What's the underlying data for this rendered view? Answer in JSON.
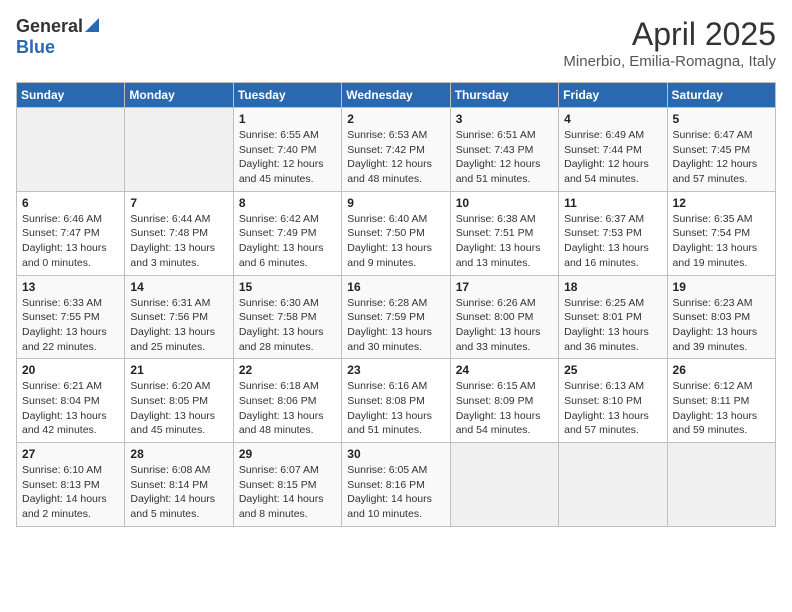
{
  "header": {
    "logo_general": "General",
    "logo_blue": "Blue",
    "month_title": "April 2025",
    "location": "Minerbio, Emilia-Romagna, Italy"
  },
  "weekdays": [
    "Sunday",
    "Monday",
    "Tuesday",
    "Wednesday",
    "Thursday",
    "Friday",
    "Saturday"
  ],
  "weeks": [
    [
      {
        "day": "",
        "info": ""
      },
      {
        "day": "",
        "info": ""
      },
      {
        "day": "1",
        "info": "Sunrise: 6:55 AM\nSunset: 7:40 PM\nDaylight: 12 hours\nand 45 minutes."
      },
      {
        "day": "2",
        "info": "Sunrise: 6:53 AM\nSunset: 7:42 PM\nDaylight: 12 hours\nand 48 minutes."
      },
      {
        "day": "3",
        "info": "Sunrise: 6:51 AM\nSunset: 7:43 PM\nDaylight: 12 hours\nand 51 minutes."
      },
      {
        "day": "4",
        "info": "Sunrise: 6:49 AM\nSunset: 7:44 PM\nDaylight: 12 hours\nand 54 minutes."
      },
      {
        "day": "5",
        "info": "Sunrise: 6:47 AM\nSunset: 7:45 PM\nDaylight: 12 hours\nand 57 minutes."
      }
    ],
    [
      {
        "day": "6",
        "info": "Sunrise: 6:46 AM\nSunset: 7:47 PM\nDaylight: 13 hours\nand 0 minutes."
      },
      {
        "day": "7",
        "info": "Sunrise: 6:44 AM\nSunset: 7:48 PM\nDaylight: 13 hours\nand 3 minutes."
      },
      {
        "day": "8",
        "info": "Sunrise: 6:42 AM\nSunset: 7:49 PM\nDaylight: 13 hours\nand 6 minutes."
      },
      {
        "day": "9",
        "info": "Sunrise: 6:40 AM\nSunset: 7:50 PM\nDaylight: 13 hours\nand 9 minutes."
      },
      {
        "day": "10",
        "info": "Sunrise: 6:38 AM\nSunset: 7:51 PM\nDaylight: 13 hours\nand 13 minutes."
      },
      {
        "day": "11",
        "info": "Sunrise: 6:37 AM\nSunset: 7:53 PM\nDaylight: 13 hours\nand 16 minutes."
      },
      {
        "day": "12",
        "info": "Sunrise: 6:35 AM\nSunset: 7:54 PM\nDaylight: 13 hours\nand 19 minutes."
      }
    ],
    [
      {
        "day": "13",
        "info": "Sunrise: 6:33 AM\nSunset: 7:55 PM\nDaylight: 13 hours\nand 22 minutes."
      },
      {
        "day": "14",
        "info": "Sunrise: 6:31 AM\nSunset: 7:56 PM\nDaylight: 13 hours\nand 25 minutes."
      },
      {
        "day": "15",
        "info": "Sunrise: 6:30 AM\nSunset: 7:58 PM\nDaylight: 13 hours\nand 28 minutes."
      },
      {
        "day": "16",
        "info": "Sunrise: 6:28 AM\nSunset: 7:59 PM\nDaylight: 13 hours\nand 30 minutes."
      },
      {
        "day": "17",
        "info": "Sunrise: 6:26 AM\nSunset: 8:00 PM\nDaylight: 13 hours\nand 33 minutes."
      },
      {
        "day": "18",
        "info": "Sunrise: 6:25 AM\nSunset: 8:01 PM\nDaylight: 13 hours\nand 36 minutes."
      },
      {
        "day": "19",
        "info": "Sunrise: 6:23 AM\nSunset: 8:03 PM\nDaylight: 13 hours\nand 39 minutes."
      }
    ],
    [
      {
        "day": "20",
        "info": "Sunrise: 6:21 AM\nSunset: 8:04 PM\nDaylight: 13 hours\nand 42 minutes."
      },
      {
        "day": "21",
        "info": "Sunrise: 6:20 AM\nSunset: 8:05 PM\nDaylight: 13 hours\nand 45 minutes."
      },
      {
        "day": "22",
        "info": "Sunrise: 6:18 AM\nSunset: 8:06 PM\nDaylight: 13 hours\nand 48 minutes."
      },
      {
        "day": "23",
        "info": "Sunrise: 6:16 AM\nSunset: 8:08 PM\nDaylight: 13 hours\nand 51 minutes."
      },
      {
        "day": "24",
        "info": "Sunrise: 6:15 AM\nSunset: 8:09 PM\nDaylight: 13 hours\nand 54 minutes."
      },
      {
        "day": "25",
        "info": "Sunrise: 6:13 AM\nSunset: 8:10 PM\nDaylight: 13 hours\nand 57 minutes."
      },
      {
        "day": "26",
        "info": "Sunrise: 6:12 AM\nSunset: 8:11 PM\nDaylight: 13 hours\nand 59 minutes."
      }
    ],
    [
      {
        "day": "27",
        "info": "Sunrise: 6:10 AM\nSunset: 8:13 PM\nDaylight: 14 hours\nand 2 minutes."
      },
      {
        "day": "28",
        "info": "Sunrise: 6:08 AM\nSunset: 8:14 PM\nDaylight: 14 hours\nand 5 minutes."
      },
      {
        "day": "29",
        "info": "Sunrise: 6:07 AM\nSunset: 8:15 PM\nDaylight: 14 hours\nand 8 minutes."
      },
      {
        "day": "30",
        "info": "Sunrise: 6:05 AM\nSunset: 8:16 PM\nDaylight: 14 hours\nand 10 minutes."
      },
      {
        "day": "",
        "info": ""
      },
      {
        "day": "",
        "info": ""
      },
      {
        "day": "",
        "info": ""
      }
    ]
  ]
}
